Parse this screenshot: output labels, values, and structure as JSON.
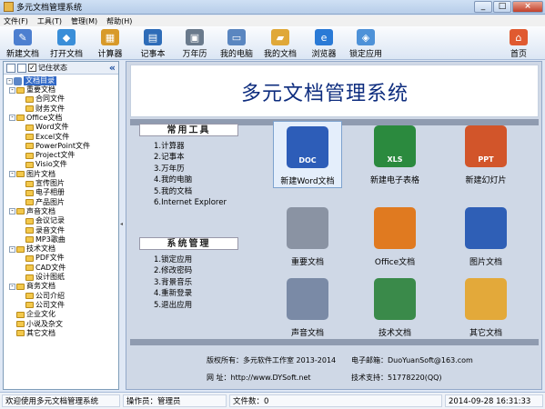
{
  "window": {
    "title": "多元文档管理系统",
    "buttons": [
      "_",
      "□",
      "×"
    ]
  },
  "menu": [
    "文件(F)",
    "工具(T)",
    "管理(M)",
    "帮助(H)"
  ],
  "toolbar": {
    "buttons": [
      {
        "label": "新建文档",
        "icon": "pencil-doc-icon",
        "color": "#4c7fd0"
      },
      {
        "label": "打开文档",
        "icon": "open-doc-icon",
        "color": "#3a8ed8"
      },
      {
        "label": "计算器",
        "icon": "calculator-icon",
        "color": "#d89a2a"
      },
      {
        "label": "记事本",
        "icon": "notebook-icon",
        "color": "#2e6cb8"
      },
      {
        "label": "万年历",
        "icon": "calendar-icon",
        "color": "#6a7a8c"
      },
      {
        "label": "我的电脑",
        "icon": "computer-icon",
        "color": "#5a86c0"
      },
      {
        "label": "我的文档",
        "icon": "my-documents-icon",
        "color": "#e0a838"
      },
      {
        "label": "浏览器",
        "icon": "browser-icon",
        "color": "#2a7ad6"
      },
      {
        "label": "锁定应用",
        "icon": "lock-icon",
        "color": "#4e92d8"
      },
      {
        "label": "首页",
        "icon": "home-icon",
        "color": "#e05a30"
      }
    ]
  },
  "left_panel": {
    "memory_label": "记住状态",
    "memory_checked": true,
    "collapse_glyph": "«",
    "root": "文档目录",
    "tree": [
      {
        "label": "重要文档",
        "level": 1,
        "expandable": true,
        "expanded": true
      },
      {
        "label": "合同文件",
        "level": 2
      },
      {
        "label": "财务文件",
        "level": 2
      },
      {
        "label": "Office文档",
        "level": 1,
        "expandable": true,
        "expanded": true
      },
      {
        "label": "Word文件",
        "level": 2
      },
      {
        "label": "Excel文件",
        "level": 2
      },
      {
        "label": "PowerPoint文件",
        "level": 2
      },
      {
        "label": "Project文件",
        "level": 2
      },
      {
        "label": "Visio文件",
        "level": 2
      },
      {
        "label": "图片文档",
        "level": 1,
        "expandable": true,
        "expanded": true
      },
      {
        "label": "宣传图片",
        "level": 2
      },
      {
        "label": "电子相册",
        "level": 2
      },
      {
        "label": "产品图片",
        "level": 2
      },
      {
        "label": "声音文档",
        "level": 1,
        "expandable": true,
        "expanded": true
      },
      {
        "label": "会议记录",
        "level": 2
      },
      {
        "label": "录音文件",
        "level": 2
      },
      {
        "label": "MP3歌曲",
        "level": 2
      },
      {
        "label": "技术文档",
        "level": 1,
        "expandable": true,
        "expanded": true
      },
      {
        "label": "PDF文件",
        "level": 2
      },
      {
        "label": "CAD文件",
        "level": 2
      },
      {
        "label": "设计图纸",
        "level": 2
      },
      {
        "label": "商务文档",
        "level": 1,
        "expandable": true,
        "expanded": true
      },
      {
        "label": "公司介绍",
        "level": 2
      },
      {
        "label": "公司文件",
        "level": 2
      },
      {
        "label": "企业文化",
        "level": 1
      },
      {
        "label": "小说及杂文",
        "level": 1
      },
      {
        "label": "其它文档",
        "level": 1
      }
    ]
  },
  "main": {
    "banner_title": "多元文档管理系统",
    "common_tools": {
      "title": "常用工具",
      "items": [
        "1.计算器",
        "2.记事本",
        "3.万年历",
        "4.我的电脑",
        "5.我的文档",
        "6.Internet Explorer"
      ]
    },
    "system_mgmt": {
      "title": "系统管理",
      "items": [
        "1.锁定应用",
        "2.修改密码",
        "3.背景音乐",
        "4.重新登录",
        "5.退出应用"
      ]
    },
    "tiles": [
      {
        "label": "新建Word文档",
        "icon": "word-doc-icon",
        "badge": "DOC",
        "color": "#2d5db8",
        "selected": true
      },
      {
        "label": "新建电子表格",
        "icon": "excel-sheet-icon",
        "badge": "XLS",
        "color": "#2b8a3e",
        "selected": false
      },
      {
        "label": "新建幻灯片",
        "icon": "powerpoint-icon",
        "badge": "PPT",
        "color": "#d2552a",
        "selected": false
      },
      {
        "label": "重要文档",
        "icon": "locked-folder-icon",
        "badge": "",
        "color": "#8a93a3",
        "selected": false
      },
      {
        "label": "Office文档",
        "icon": "office-icon",
        "badge": "",
        "color": "#e07a20",
        "selected": false
      },
      {
        "label": "图片文档",
        "icon": "picture-book-icon",
        "badge": "",
        "color": "#2f5fb6",
        "selected": false
      },
      {
        "label": "声音文档",
        "icon": "sound-disc-icon",
        "badge": "",
        "color": "#7a8aa6",
        "selected": false
      },
      {
        "label": "技术文档",
        "icon": "network-icon",
        "badge": "",
        "color": "#3a8a4a",
        "selected": false
      },
      {
        "label": "其它文档",
        "icon": "other-folder-icon",
        "badge": "",
        "color": "#e3a93a",
        "selected": false
      }
    ],
    "footer": {
      "copyright": "版权所有：多元软件工作室 2013-2014",
      "email": "电子邮箱：DuoYuanSoft@163.com",
      "website": "网     址：http://www.DYSoft.net",
      "support": "技术支持：51778220(QQ)"
    }
  },
  "status": {
    "welcome": "欢迎使用多元文档管理系统",
    "operator": "操作员：管理员",
    "file_count": "文件数：0",
    "datetime": "2014-09-28  16:31:33"
  }
}
